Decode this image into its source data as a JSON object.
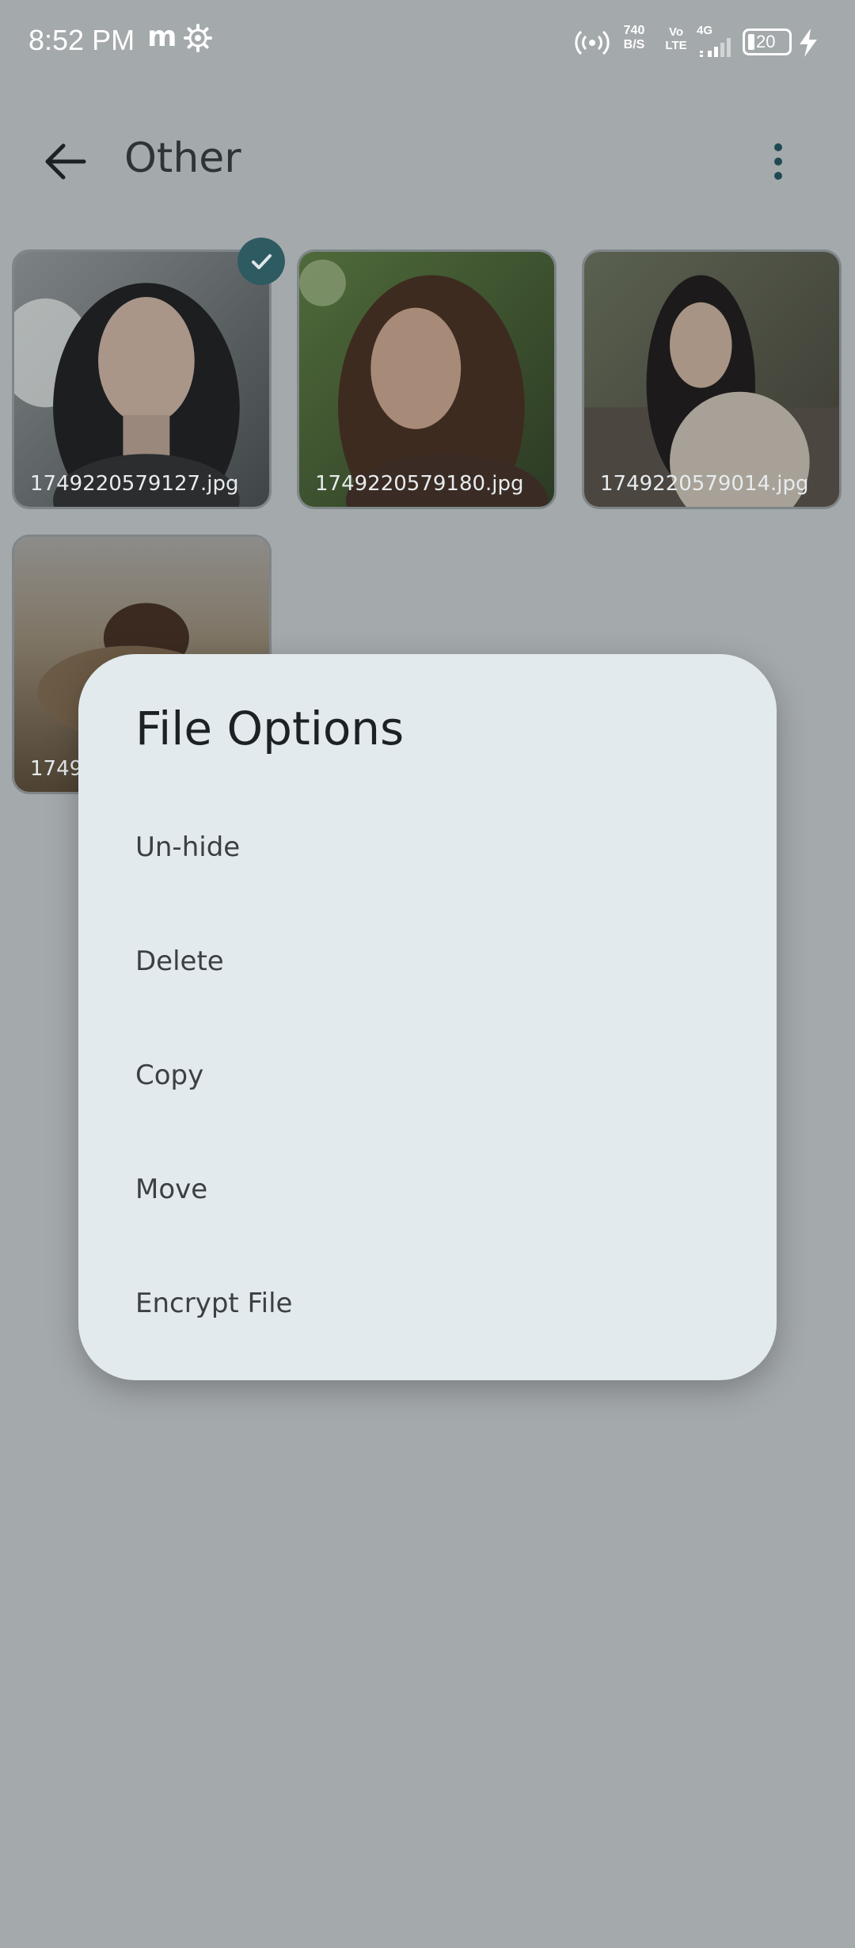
{
  "status_bar": {
    "time": "8:52 PM",
    "app_letter": "m",
    "speed_top": "740",
    "speed_bottom": "B/S",
    "volte_top": "Vo",
    "volte_bottom": "LTE",
    "network": "4G",
    "battery": "20",
    "icons": [
      "settings-gear-icon",
      "hotspot-icon",
      "signal-icon",
      "battery-icon",
      "charging-bolt-icon"
    ]
  },
  "app_bar": {
    "title": "Other",
    "back_icon": "arrow-left-icon",
    "menu_icon": "more-vert-icon"
  },
  "thumbnails": [
    {
      "name": "1749220579127.jpg",
      "selected": true
    },
    {
      "name": "1749220579180.jpg",
      "selected": false
    },
    {
      "name": "1749220579014.jpg",
      "selected": false
    },
    {
      "name": "1749",
      "selected": false
    }
  ],
  "dialog": {
    "title": "File Options",
    "items": [
      "Un-hide",
      "Delete",
      "Copy",
      "Move",
      "Encrypt File"
    ]
  },
  "colors": {
    "background_dim": "#a4a9ac",
    "dialog_bg": "#e2eaed",
    "accent": "#2e5a62"
  }
}
